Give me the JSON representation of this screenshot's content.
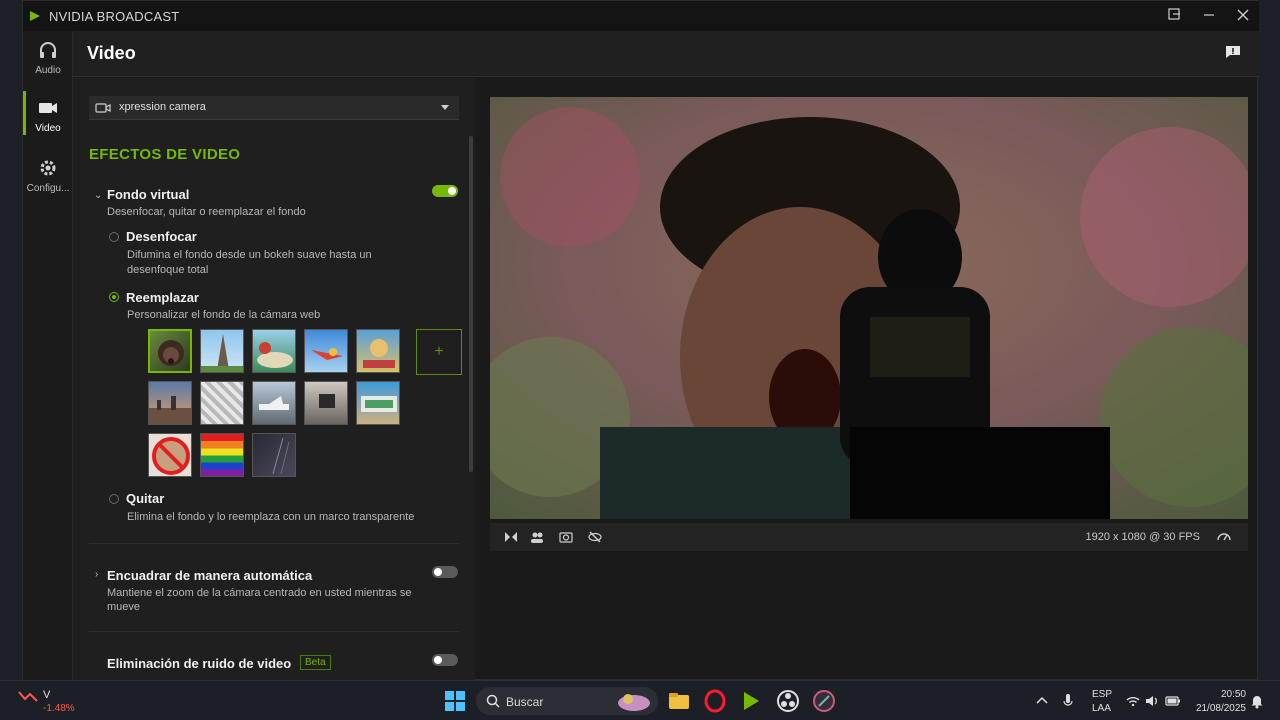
{
  "window": {
    "title": "NVIDIA BROADCAST",
    "controls": [
      "pin-icon",
      "minimize-icon",
      "close-icon"
    ]
  },
  "nav": {
    "items": [
      {
        "label": "Audio",
        "icon": "headphones-icon"
      },
      {
        "label": "Video",
        "icon": "camera-icon",
        "active": true
      },
      {
        "label": "Configu...",
        "icon": "gear-icon"
      }
    ]
  },
  "header": {
    "title": "Video"
  },
  "camera": {
    "selected": "xpression camera"
  },
  "effects": {
    "section_title": "EFECTOS DE VIDEO",
    "virtual_bg": {
      "title": "Fondo virtual",
      "desc": "Desenfocar, quitar o reemplazar el fondo",
      "enabled": true,
      "options": [
        {
          "title": "Desenfocar",
          "desc1": "Difumina el fondo desde un bokeh suave hasta un",
          "desc2": "desenfoque total",
          "selected": false
        },
        {
          "title": "Reemplazar",
          "desc1": "Personalizar el fondo de la cámara web",
          "selected": true
        },
        {
          "title": "Quitar",
          "desc1": "Elimina el fondo y lo reemplaza con un marco transparente",
          "selected": false
        }
      ],
      "add_label": "+"
    },
    "auto_frame": {
      "title": "Encuadrar de manera automática",
      "desc1": "Mantiene el zoom de la cámara centrado en usted mientras se",
      "desc2": "mueve",
      "enabled": false
    },
    "noise": {
      "title": "Eliminación de ruido de video",
      "badge": "Beta",
      "enabled": false
    }
  },
  "preview": {
    "resolution": "1920 x 1080 @ 30 FPS"
  },
  "taskbar": {
    "search_placeholder": "Buscar",
    "stock_name": "V",
    "stock_change": "-1.48%",
    "lang1": "ESP",
    "lang2": "LAA",
    "time": "20:50",
    "date": "21/08/2025"
  },
  "colors": {
    "accent": "#76b900",
    "stock_negative": "#ff5a4a"
  }
}
